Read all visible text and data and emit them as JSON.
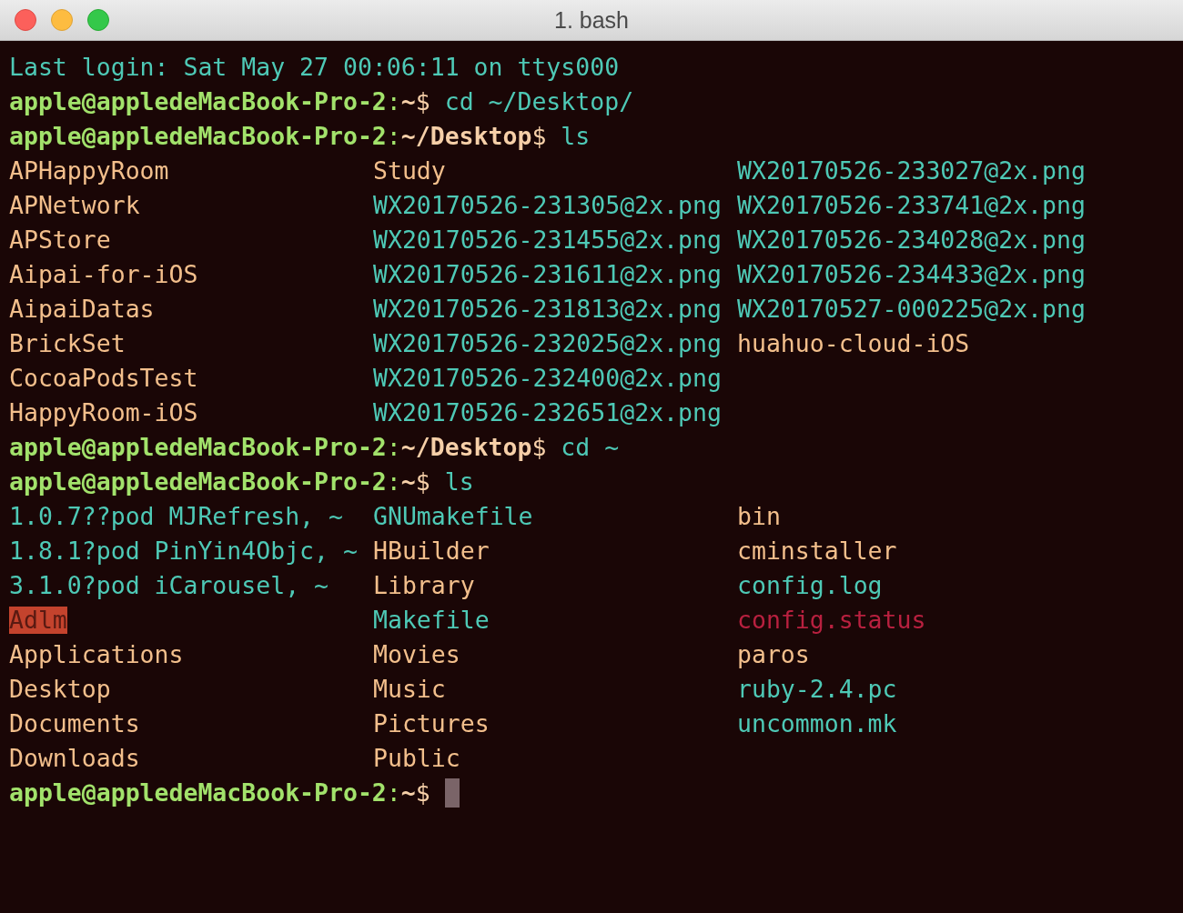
{
  "window": {
    "title": "1. bash"
  },
  "lines": [
    {
      "kind": "text",
      "segments": [
        {
          "kind": "info",
          "text": "Last login: Sat May 27 00:06:11 on ttys000"
        }
      ]
    },
    {
      "kind": "text",
      "segments": [
        {
          "kind": "user",
          "text": "apple@appledeMacBook-Pro-2"
        },
        {
          "kind": "colon",
          "text": ":"
        },
        {
          "kind": "path",
          "text": "~"
        },
        {
          "kind": "dollar",
          "text": "$"
        },
        {
          "kind": "command",
          "text": " cd ~/Desktop/"
        }
      ]
    },
    {
      "kind": "text",
      "segments": [
        {
          "kind": "user",
          "text": "apple@appledeMacBook-Pro-2"
        },
        {
          "kind": "colon",
          "text": ":"
        },
        {
          "kind": "path",
          "text": "~/Desktop"
        },
        {
          "kind": "dollar",
          "text": "$"
        },
        {
          "kind": "command",
          "text": " ls"
        }
      ]
    },
    {
      "kind": "listing",
      "rows": [
        [
          {
            "kind": "dir",
            "text": "APHappyRoom"
          },
          {
            "kind": "dir",
            "text": "Study"
          },
          {
            "kind": "file",
            "text": "WX20170526-233027@2x.png"
          }
        ],
        [
          {
            "kind": "dir",
            "text": "APNetwork"
          },
          {
            "kind": "file",
            "text": "WX20170526-231305@2x.png"
          },
          {
            "kind": "file",
            "text": "WX20170526-233741@2x.png"
          }
        ],
        [
          {
            "kind": "dir",
            "text": "APStore"
          },
          {
            "kind": "file",
            "text": "WX20170526-231455@2x.png"
          },
          {
            "kind": "file",
            "text": "WX20170526-234028@2x.png"
          }
        ],
        [
          {
            "kind": "dir",
            "text": "Aipai-for-iOS"
          },
          {
            "kind": "file",
            "text": "WX20170526-231611@2x.png"
          },
          {
            "kind": "file",
            "text": "WX20170526-234433@2x.png"
          }
        ],
        [
          {
            "kind": "dir",
            "text": "AipaiDatas"
          },
          {
            "kind": "file",
            "text": "WX20170526-231813@2x.png"
          },
          {
            "kind": "file",
            "text": "WX20170527-000225@2x.png"
          }
        ],
        [
          {
            "kind": "dir",
            "text": "BrickSet"
          },
          {
            "kind": "file",
            "text": "WX20170526-232025@2x.png"
          },
          {
            "kind": "dir",
            "text": "huahuo-cloud-iOS"
          }
        ],
        [
          {
            "kind": "dir",
            "text": "CocoaPodsTest"
          },
          {
            "kind": "file",
            "text": "WX20170526-232400@2x.png"
          }
        ],
        [
          {
            "kind": "dir",
            "text": "HappyRoom-iOS"
          },
          {
            "kind": "file",
            "text": "WX20170526-232651@2x.png"
          }
        ]
      ]
    },
    {
      "kind": "text",
      "segments": [
        {
          "kind": "user",
          "text": "apple@appledeMacBook-Pro-2"
        },
        {
          "kind": "colon",
          "text": ":"
        },
        {
          "kind": "path",
          "text": "~/Desktop"
        },
        {
          "kind": "dollar",
          "text": "$"
        },
        {
          "kind": "command",
          "text": " cd ~"
        }
      ]
    },
    {
      "kind": "text",
      "segments": [
        {
          "kind": "user",
          "text": "apple@appledeMacBook-Pro-2"
        },
        {
          "kind": "colon",
          "text": ":"
        },
        {
          "kind": "path",
          "text": "~"
        },
        {
          "kind": "dollar",
          "text": "$"
        },
        {
          "kind": "command",
          "text": " ls"
        }
      ]
    },
    {
      "kind": "listing",
      "rows": [
        [
          {
            "kind": "file",
            "text": "1.0.7??pod MJRefresh, ~"
          },
          {
            "kind": "file",
            "text": "GNUmakefile"
          },
          {
            "kind": "dir",
            "text": "bin"
          }
        ],
        [
          {
            "kind": "file",
            "text": "1.8.1?pod PinYin4Objc, ~"
          },
          {
            "kind": "dir",
            "text": "HBuilder"
          },
          {
            "kind": "dir",
            "text": "cminstaller"
          }
        ],
        [
          {
            "kind": "file",
            "text": "3.1.0?pod iCarousel, ~"
          },
          {
            "kind": "dir",
            "text": "Library"
          },
          {
            "kind": "file",
            "text": "config.log"
          }
        ],
        [
          {
            "kind": "special",
            "text": "Adlm"
          },
          {
            "kind": "file",
            "text": "Makefile"
          },
          {
            "kind": "exec",
            "text": "config.status"
          }
        ],
        [
          {
            "kind": "dir",
            "text": "Applications"
          },
          {
            "kind": "dir",
            "text": "Movies"
          },
          {
            "kind": "dir",
            "text": "paros"
          }
        ],
        [
          {
            "kind": "dir",
            "text": "Desktop"
          },
          {
            "kind": "dir",
            "text": "Music"
          },
          {
            "kind": "file",
            "text": "ruby-2.4.pc"
          }
        ],
        [
          {
            "kind": "dir",
            "text": "Documents"
          },
          {
            "kind": "dir",
            "text": "Pictures"
          },
          {
            "kind": "file",
            "text": "uncommon.mk"
          }
        ],
        [
          {
            "kind": "dir",
            "text": "Downloads"
          },
          {
            "kind": "dir",
            "text": "Public"
          }
        ]
      ]
    },
    {
      "kind": "text",
      "cursor": true,
      "segments": [
        {
          "kind": "user",
          "text": "apple@appledeMacBook-Pro-2"
        },
        {
          "kind": "colon",
          "text": ":"
        },
        {
          "kind": "path",
          "text": "~"
        },
        {
          "kind": "dollar",
          "text": "$"
        }
      ]
    }
  ]
}
